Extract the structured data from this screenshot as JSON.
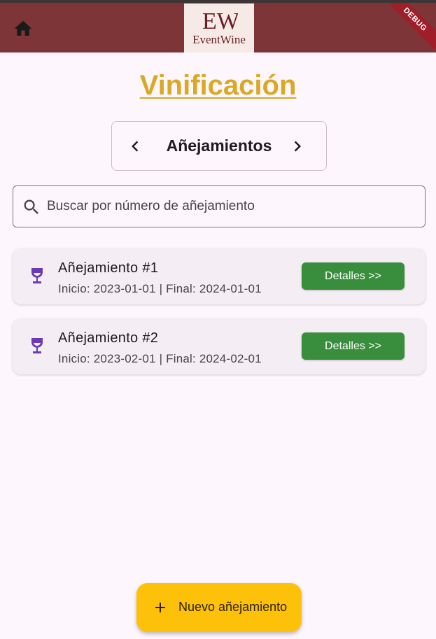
{
  "header": {
    "home_icon": "home-icon",
    "logo_mark": "EW",
    "logo_text": "EventWine",
    "debug_banner": "DEBUG",
    "bar_color": "#7d3538"
  },
  "page": {
    "title": "Vinificación"
  },
  "selector": {
    "label": "Añejamientos",
    "prev_icon": "chevron-left-icon",
    "next_icon": "chevron-right-icon"
  },
  "search": {
    "placeholder": "Buscar por número de añejamiento",
    "value": ""
  },
  "items": [
    {
      "icon": "wine-glass-icon",
      "title": "Añejamiento #1",
      "subtitle": "Inicio: 2023-01-01 | Final: 2024-01-01",
      "button_label": "Detalles >>"
    },
    {
      "icon": "wine-glass-icon",
      "title": "Añejamiento #2",
      "subtitle": "Inicio: 2023-02-01 | Final: 2024-02-01",
      "button_label": "Detalles >>"
    }
  ],
  "fab": {
    "icon": "plus-icon",
    "label": "Nuevo añejamiento"
  },
  "colors": {
    "title": "#dba826",
    "button": "#388e3c",
    "fab": "#fec10a",
    "wine_icon": "#6a3bb5"
  }
}
